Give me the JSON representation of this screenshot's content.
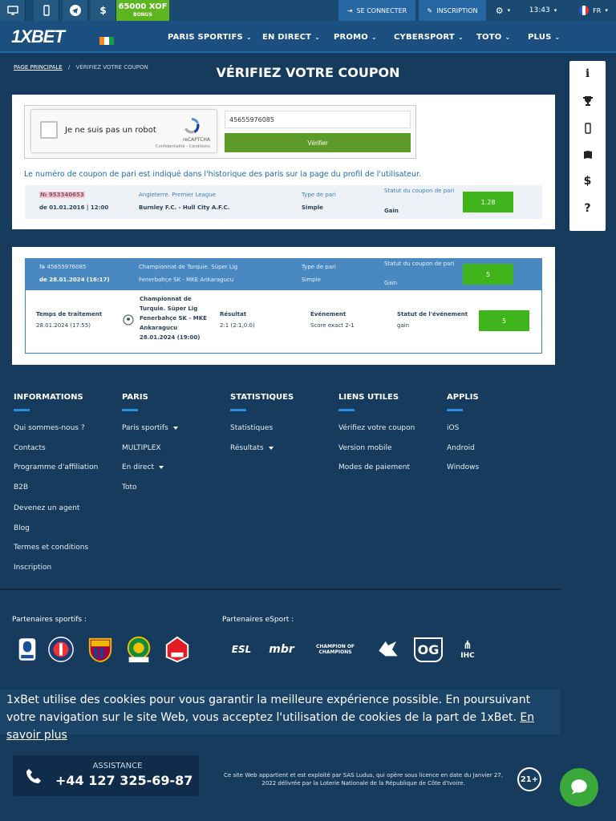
{
  "topbar": {
    "icons": [
      "desktop-icon",
      "mobile-icon",
      "telegram-icon",
      "dollar-icon"
    ],
    "bonus_amount": "65000 XOF",
    "bonus_label": "BONUS",
    "login_label": "SE CONNECTER",
    "register_label": "INSCRIPTION",
    "time": "13:43",
    "language": "FR"
  },
  "header": {
    "logo": "1XBET",
    "nav": [
      {
        "label": "PARIS SPORTIFS"
      },
      {
        "label": "EN DIRECT"
      },
      {
        "label": "PROMO"
      },
      {
        "label": "CYBERSPORT"
      },
      {
        "label": "TOTO"
      },
      {
        "label": "PLUS"
      }
    ]
  },
  "breadcrumb": {
    "home": "PAGE PRINCIPALE",
    "separator": "/",
    "current": "VÉRIFIEZ VOTRE COUPON"
  },
  "page_title": "VÉRIFIEZ VOTRE COUPON",
  "captcha": {
    "label": "Je ne suis pas un robot",
    "brand": "reCAPTCHA",
    "legal": "Confidentialité - Conditions"
  },
  "coupon_form": {
    "value": "45655976085",
    "button": "Vérifier"
  },
  "info_text": "Le numéro de coupon de pari est indiqué dans l'historique des paris sur la page du profil de l'utilisateur.",
  "example": {
    "number": "№ 953340653",
    "date": "de 01.01.2016 | 12:00",
    "league": "Angleterre. Premier League",
    "match": "Burnley F.C. - Hull City A.F.C.",
    "bet_type_label": "Type de pari",
    "bet_type": "Simple",
    "status_label": "Statut du coupon de pari",
    "status": "Gain",
    "odds": "1.28"
  },
  "result": {
    "number": "№ 45655976085",
    "date": "de 28.01.2024 (16:17)",
    "league": "Championnat de Turquie. Süper Lig",
    "match": "Fenerbahçe SK - MKE Ankaragucu",
    "bet_type_label": "Type de pari",
    "bet_type": "Simple",
    "status_label": "Statut du coupon de pari",
    "status": "Gain",
    "odds": "5",
    "processing_label": "Temps de traitement",
    "processing_time": "28.01.2024 (17:55)",
    "event_details": "Championnat de Turquie. Süper Lig Fenerbahçe SK - MKE Ankaragucu 28.01.2024 (19:00)",
    "result_label": "Résultat",
    "result_value": "2:1 (2:1,0:0)",
    "event_label": "Événement",
    "event_value": "Score exact 2-1",
    "event_status_label": "Statut de l'événement",
    "event_status": "gain",
    "event_odds": "5"
  },
  "footer": {
    "columns": [
      {
        "title": "INFORMATIONS",
        "links": [
          "Qui sommes-nous ?",
          "Contacts",
          "Programme d'affiliation",
          "B2B",
          "Devenez un agent",
          "Blog",
          "Termes et conditions",
          "Inscription"
        ]
      },
      {
        "title": "PARIS",
        "links": [
          "Paris sportifs",
          "MULTIPLEX",
          "En direct",
          "Toto"
        ]
      },
      {
        "title": "STATISTIQUES",
        "links": [
          "Statistiques",
          "Résultats"
        ]
      },
      {
        "title": "LIENS UTILES",
        "links": [
          "Vérifiez votre coupon",
          "Version mobile",
          "Modes de paiement"
        ]
      },
      {
        "title": "APPLIS",
        "links": [
          "iOS",
          "Android",
          "Windows"
        ]
      }
    ],
    "sport_partners_title": "Partenaires sportifs :",
    "esport_partners_title": "Partenaires eSport :",
    "esport_partners": [
      "ESL",
      "mbr",
      "CHAMPION OF CHAMPIONS",
      "OG",
      "IHC"
    ]
  },
  "cookie": {
    "text": "1xBet utilise des cookies pour vous garantir la meilleure expérience possible. En poursuivant votre navigation sur le site Web, vous acceptez l'utilisation de cookies de la part de 1xBet.",
    "link": "En savoir plus"
  },
  "support": {
    "label": "ASSISTANCE",
    "phone": "+44 127 325-69-87"
  },
  "legal": "Ce site Web appartient et est exploité par SAS Ludus, qui opère sous licence en date du Janvier 27, 2022 délivrée par la Loterie Nationale de la République de Côte d'Ivoire.",
  "age_badge": "21+",
  "colors": {
    "accent": "#1f6aa8",
    "green": "#3fb51b",
    "panel_blue": "#4a88c2"
  }
}
